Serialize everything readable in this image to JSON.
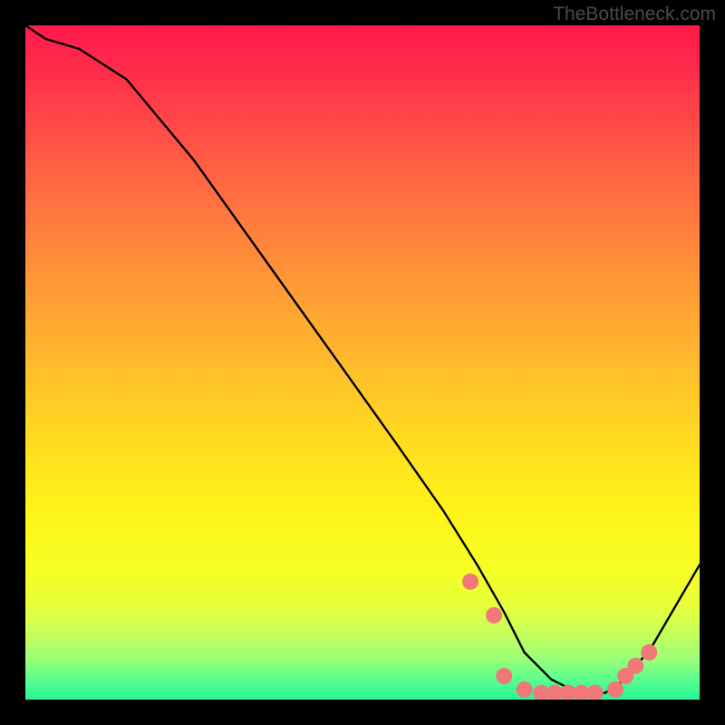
{
  "watermark": "TheBottleneck.com",
  "chart_data": {
    "type": "line",
    "title": "",
    "xlabel": "",
    "ylabel": "",
    "xlim": [
      0,
      100
    ],
    "ylim": [
      0,
      100
    ],
    "series": [
      {
        "name": "curve",
        "x": [
          0,
          3,
          8,
          15,
          25,
          35,
          45,
          55,
          62,
          67,
          71,
          74,
          78,
          82,
          86,
          89,
          93,
          100
        ],
        "y": [
          100,
          98,
          96.5,
          92,
          80,
          66,
          52,
          38,
          28,
          20,
          13,
          7,
          3,
          1,
          1,
          3,
          8,
          20
        ]
      }
    ],
    "markers": {
      "name": "dots",
      "x": [
        66,
        69.5,
        71,
        74,
        76.5,
        78.5,
        80.5,
        82.5,
        84.5,
        87.5,
        89,
        90.5,
        92.5
      ],
      "y": [
        17.5,
        12.5,
        3.5,
        1.5,
        1.0,
        1.0,
        1.0,
        1.0,
        1.0,
        1.5,
        3.5,
        5.0,
        7.0
      ],
      "color": "#f07878",
      "size": 9
    },
    "gradient_stops": [
      {
        "pos": 0,
        "color": "#ff1a4b"
      },
      {
        "pos": 14,
        "color": "#ff4648"
      },
      {
        "pos": 34,
        "color": "#ff8b3a"
      },
      {
        "pos": 54,
        "color": "#ffc728"
      },
      {
        "pos": 72,
        "color": "#fff31a"
      },
      {
        "pos": 90,
        "color": "#c8ff5a"
      },
      {
        "pos": 100,
        "color": "#28f59a"
      }
    ]
  }
}
